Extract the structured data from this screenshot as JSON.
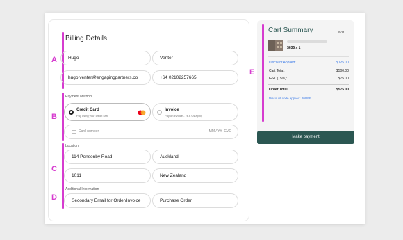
{
  "billing": {
    "title": "Billing Details",
    "first_name": "Hugo",
    "last_name": "Venter",
    "email": "hugo.venter@engagingpartners.co",
    "phone": "+64 02102257665"
  },
  "payment": {
    "section_label": "Payment Method",
    "credit_card": {
      "title": "Credit Card",
      "subtitle": "Pay using your credit card"
    },
    "invoice": {
      "title": "Invoice",
      "subtitle": "Pay on invoice - Ts & Cs apply"
    },
    "card_number_placeholder": "Card number",
    "expiry_cvc_placeholder": "MM / YY  CVC"
  },
  "location": {
    "section_label": "Location",
    "street": "114 Ponsonby Road",
    "city": "Auckland",
    "postcode": "1011",
    "country": "New Zealand"
  },
  "additional": {
    "section_label": "Additional Information",
    "secondary_email_placeholder": "Secondary Email for Order/Invoice",
    "purchase_order_placeholder": "Purchase Order"
  },
  "markers": {
    "a": "A",
    "b": "B",
    "c": "C",
    "d": "D",
    "e": "E"
  },
  "cart": {
    "title": "Cart Summary",
    "edit_label": "Edit",
    "item_price": "$635 x 1",
    "discount_label": "Discount Applied:",
    "discount_value": "$125.00",
    "total_label": "Cart Total:",
    "total_value": "$500.00",
    "gst_label": "GST (15%):",
    "gst_value": "$75.00",
    "order_total_label": "Order Total:",
    "order_total_value": "$575.00",
    "discount_code_text": "Discount code applied: 20OFF"
  },
  "actions": {
    "make_payment": "Make payment"
  },
  "colors": {
    "accent_marker": "#d63ccf",
    "primary_button": "#2b5752",
    "discount_blue": "#3d7ce8",
    "mastercard_red": "#eb001b",
    "mastercard_orange": "#f79e1b"
  }
}
